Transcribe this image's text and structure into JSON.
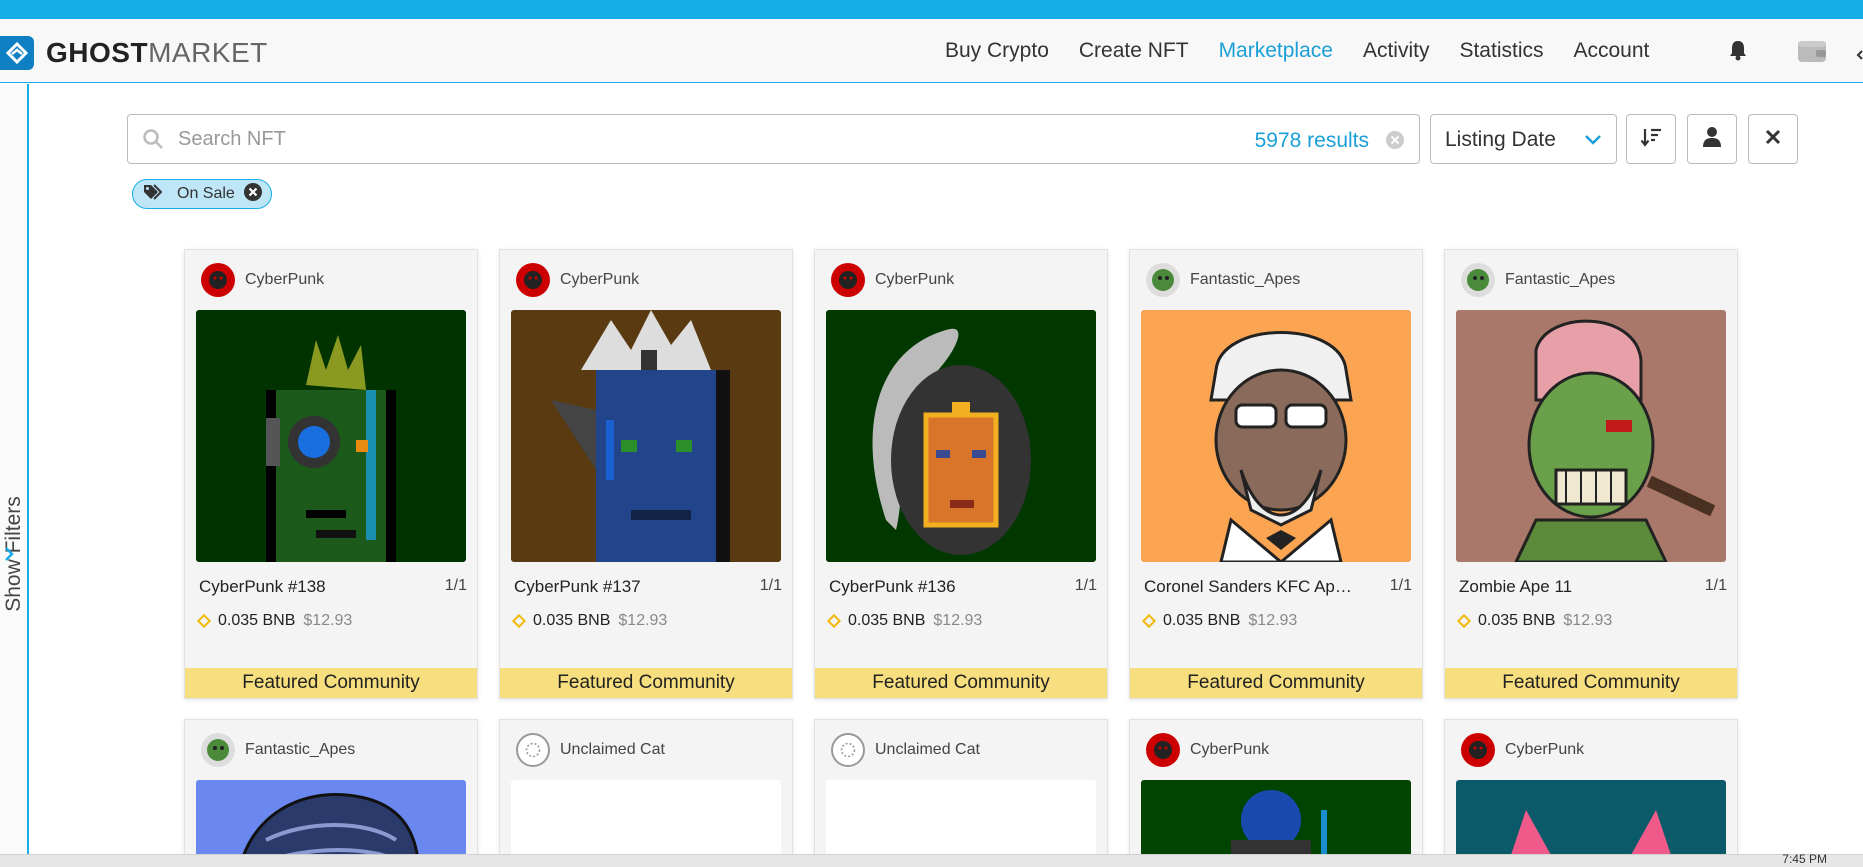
{
  "brand": {
    "name_bold": "GHOST",
    "name_light": "MARKET"
  },
  "nav": {
    "links": [
      "Buy Crypto",
      "Create NFT",
      "Marketplace",
      "Activity",
      "Statistics",
      "Account"
    ],
    "active": "Marketplace"
  },
  "sidebar": {
    "label": "Show  Filters"
  },
  "search": {
    "placeholder": "Search NFT",
    "results": "5978 results"
  },
  "sort": {
    "selected": "Listing Date"
  },
  "filters": {
    "chips": [
      {
        "label": "On Sale"
      }
    ]
  },
  "colors": {
    "accent": "#17aee8",
    "link_active": "#1a9fd8",
    "featured_bg": "#f7de7e",
    "bnb": "#f0b90b"
  },
  "cards": [
    {
      "creator": "CyberPunk",
      "name": "CyberPunk #138",
      "edition": "1/1",
      "price": "0.035 BNB",
      "fiat": "$12.93",
      "tag": "Featured Community"
    },
    {
      "creator": "CyberPunk",
      "name": "CyberPunk #137",
      "edition": "1/1",
      "price": "0.035 BNB",
      "fiat": "$12.93",
      "tag": "Featured Community"
    },
    {
      "creator": "CyberPunk",
      "name": "CyberPunk #136",
      "edition": "1/1",
      "price": "0.035 BNB",
      "fiat": "$12.93",
      "tag": "Featured Community"
    },
    {
      "creator": "Fantastic_Apes",
      "name": "Coronel Sanders KFC Ape...",
      "edition": "1/1",
      "price": "0.035 BNB",
      "fiat": "$12.93",
      "tag": "Featured Community"
    },
    {
      "creator": "Fantastic_Apes",
      "name": "Zombie Ape 11",
      "edition": "1/1",
      "price": "0.035 BNB",
      "fiat": "$12.93",
      "tag": "Featured Community"
    },
    {
      "creator": "Fantastic_Apes"
    },
    {
      "creator": "Unclaimed Cat"
    },
    {
      "creator": "Unclaimed Cat"
    },
    {
      "creator": "CyberPunk"
    },
    {
      "creator": "CyberPunk"
    }
  ],
  "taskbar": {
    "time": "7:45 PM"
  }
}
